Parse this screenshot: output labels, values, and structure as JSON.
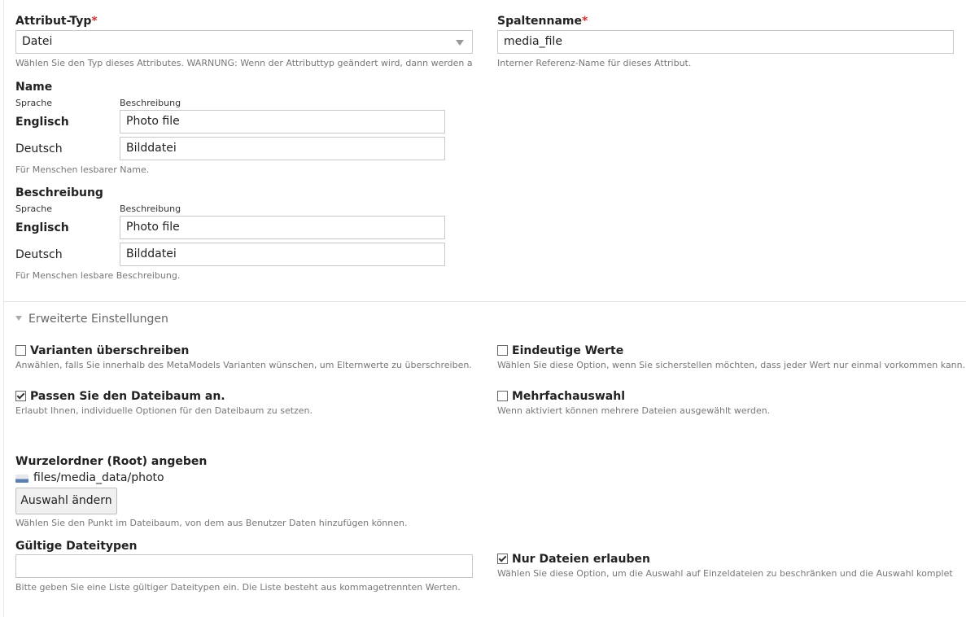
{
  "attribute_type": {
    "label": "Attribut-Typ",
    "required_mark": "*",
    "value": "Datei",
    "hint": "Wählen Sie den Typ dieses Attributes. WARNUNG: Wenn der Attributtyp geändert wird, dann werden alle"
  },
  "column_name": {
    "label": "Spaltenname",
    "required_mark": "*",
    "value": "media_file",
    "hint": "Interner Referenz-Name für dieses Attribut."
  },
  "name_section": {
    "label": "Name",
    "col_language": "Sprache",
    "col_description": "Beschreibung",
    "rows": [
      {
        "language": "Englisch",
        "value": "Photo file"
      },
      {
        "language": "Deutsch",
        "value": "Bilddatei"
      }
    ],
    "hint": "Für Menschen lesbarer Name."
  },
  "description_section": {
    "label": "Beschreibung",
    "col_language": "Sprache",
    "col_description": "Beschreibung",
    "rows": [
      {
        "language": "Englisch",
        "value": "Photo file"
      },
      {
        "language": "Deutsch",
        "value": "Bilddatei"
      }
    ],
    "hint": "Für Menschen lesbare Beschreibung."
  },
  "advanced": {
    "legend": "Erweiterte Einstellungen",
    "variant_override": {
      "label": "Varianten überschreiben",
      "checked": false,
      "hint": "Anwählen, falls Sie innerhalb des MetaModels Varianten wünschen, um Elternwerte zu überschreiben."
    },
    "unique_values": {
      "label": "Eindeutige Werte",
      "checked": false,
      "hint": "Wählen Sie diese Option, wenn Sie sicherstellen möchten, dass jeder Wert nur einmal vorkommen kann."
    },
    "customize_filetree": {
      "label": "Passen Sie den Dateibaum an.",
      "checked": true,
      "hint": "Erlaubt Ihnen, individuelle Optionen für den Dateibaum zu setzen."
    },
    "multiple_selection": {
      "label": "Mehrfachauswahl",
      "checked": false,
      "hint": "Wenn aktiviert können mehrere Dateien ausgewählt werden."
    },
    "root_folder": {
      "label": "Wurzelordner (Root) angeben",
      "path": "files/media_data/photo",
      "button": "Auswahl ändern",
      "hint": "Wählen Sie den Punkt im Dateibaum, von dem aus Benutzer Daten hinzufügen können."
    },
    "valid_filetypes": {
      "label": "Gültige Dateitypen",
      "value": "",
      "hint": "Bitte geben Sie eine Liste gültiger Dateitypen ein. Die Liste besteht aus kommagetrennten Werten."
    },
    "files_only": {
      "label": "Nur Dateien erlauben",
      "checked": true,
      "hint": "Wählen Sie diese Option, um die Auswahl auf Einzeldateien zu beschränken und die Auswahl kompletter"
    }
  }
}
